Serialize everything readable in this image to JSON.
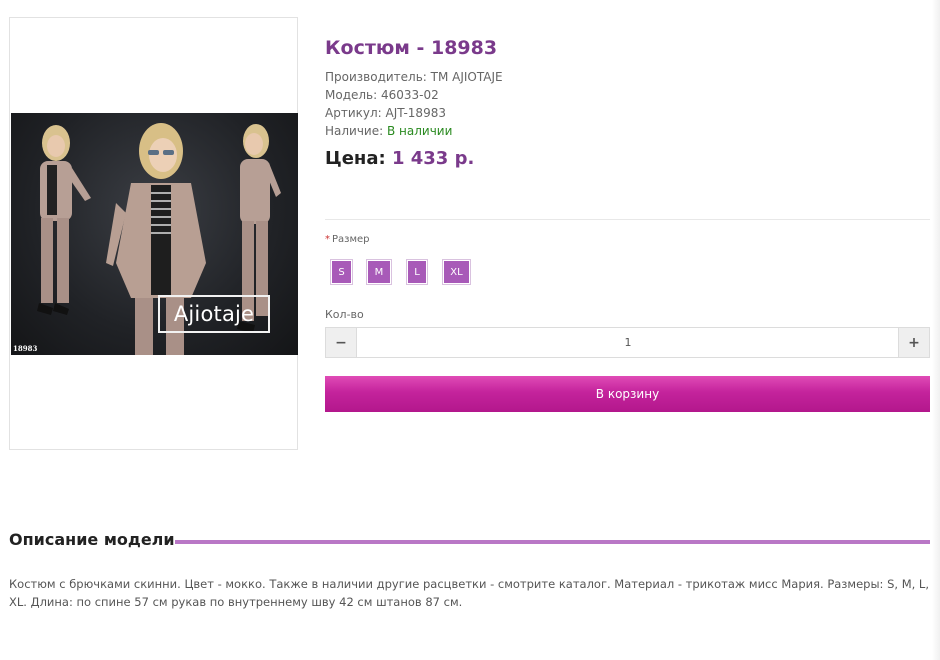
{
  "product": {
    "title": "Костюм - 18983",
    "manufacturer": "Производитель: ТМ AJIOTAJE",
    "model": "Модель: 46033-02",
    "sku": "Артикул: AJT-18983",
    "availability_label": "Наличие: ",
    "availability_value": "В наличии",
    "price_label": "Цена: ",
    "price_value": "1 433 р.",
    "image": {
      "brand_text": "Ajiotaje",
      "code_text": "18983"
    }
  },
  "options": {
    "size_label": "Размер",
    "required_mark": "*",
    "sizes": [
      "S",
      "M",
      "L",
      "XL"
    ]
  },
  "quantity": {
    "label": "Кол-во",
    "value": "1",
    "minus": "−",
    "plus": "+"
  },
  "cart_button": "В корзину",
  "description": {
    "heading": "Описание модели",
    "text": "Костюм с брючками скинни. Цвет - мокко. Также в наличии другие расцветки - смотрите каталог. Материал - трикотаж мисс Мария. Размеры: S, M, L, XL. Длина: по спине 57 см рукав по внутреннему шву 42 см штанов 87 см."
  },
  "colors": {
    "accent_purple": "#7a3a8b",
    "size_button": "#a85ab8",
    "cart_gradient_top": "#e04bb6",
    "cart_gradient_bottom": "#b3178c",
    "in_stock_green": "#2a8a20"
  }
}
